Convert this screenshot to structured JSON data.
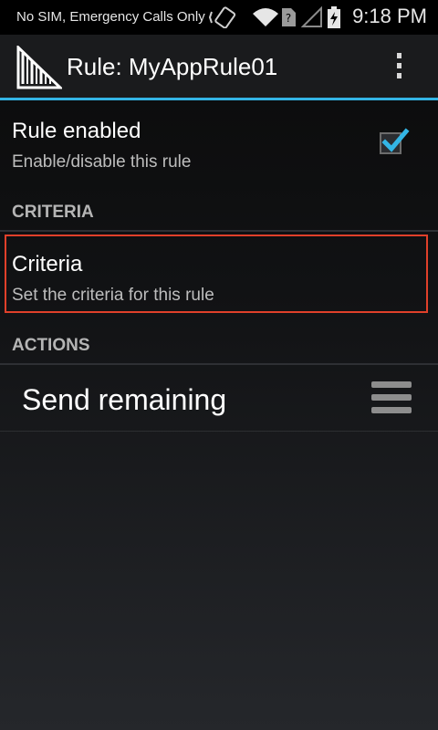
{
  "status_bar": {
    "carrier": "No SIM, Emergency Calls Only",
    "time": "9:18 PM",
    "icons": [
      "vibrate-icon",
      "wifi-icon",
      "no-sim-icon",
      "signal-icon",
      "battery-charging-icon"
    ]
  },
  "action_bar": {
    "title": "Rule: MyAppRule01",
    "accent_color": "#33b5e5"
  },
  "preferences": {
    "rule_enabled": {
      "title": "Rule enabled",
      "summary": "Enable/disable this rule",
      "checked": true
    },
    "criteria_header": "CRITERIA",
    "criteria": {
      "title": "Criteria",
      "summary": "Set the criteria for this rule"
    },
    "actions_header": "ACTIONS",
    "actions": [
      {
        "label": "Send remaining"
      }
    ]
  },
  "highlight_color": "#e0402a"
}
